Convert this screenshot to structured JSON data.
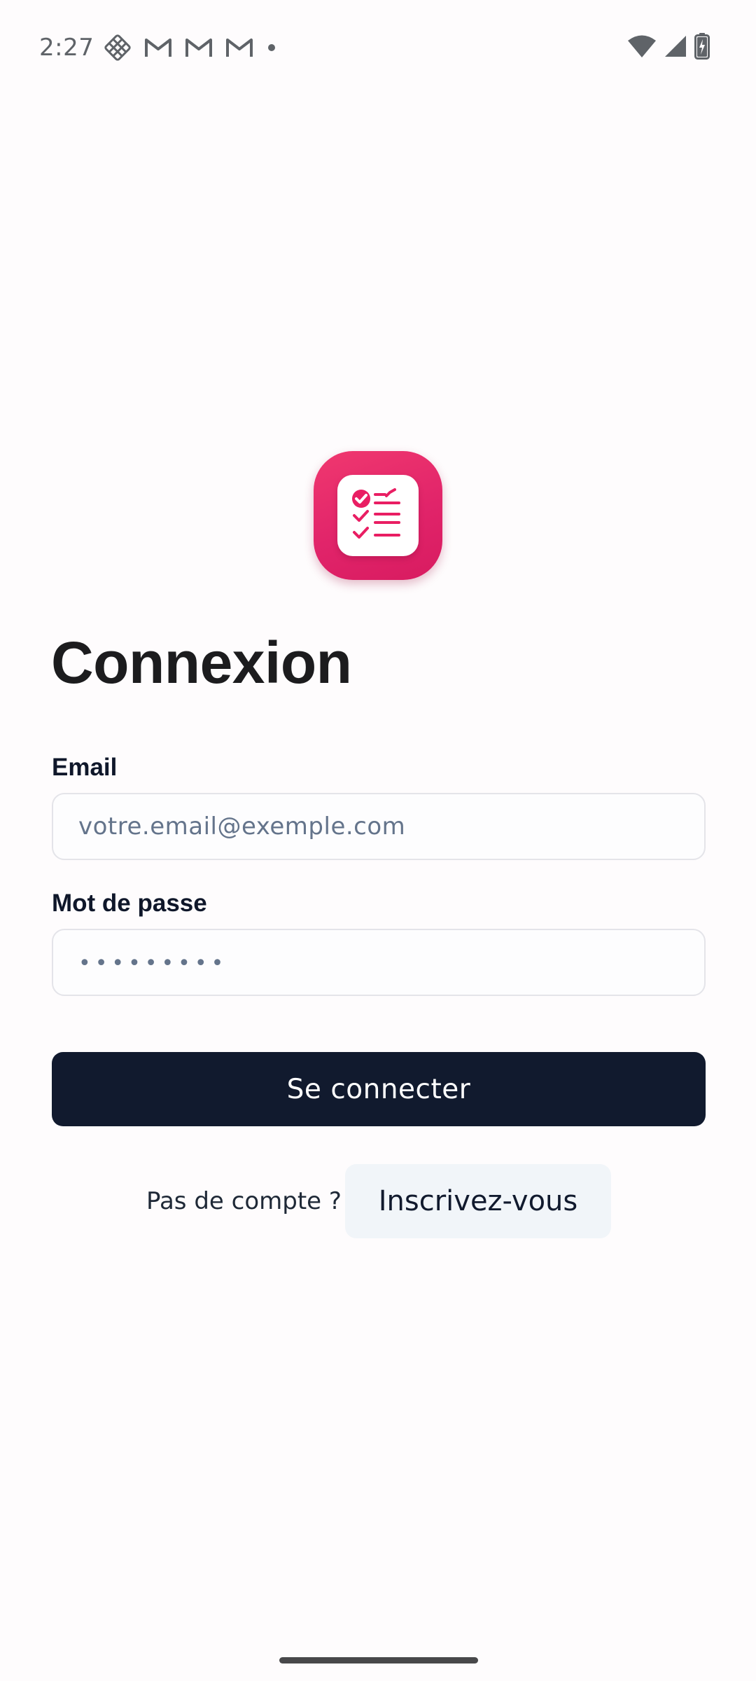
{
  "status_bar": {
    "time": "2:27",
    "left_icons": [
      "grid-app-icon",
      "gmail-icon",
      "gmail-icon",
      "gmail-icon",
      "dot-icon"
    ],
    "right_icons": [
      "wifi-icon",
      "cellular-signal-icon",
      "battery-charging-icon"
    ]
  },
  "app": {
    "logo_icon": "checklist-app-icon",
    "brand_color": "#e91e63"
  },
  "login": {
    "title": "Connexion",
    "email_label": "Email",
    "email_placeholder": "votre.email@exemple.com",
    "email_value": "",
    "password_label": "Mot de passe",
    "password_placeholder": "•••••••••",
    "password_value": "",
    "submit_label": "Se connecter",
    "signup_prompt": "Pas de compte ?",
    "signup_label": "Inscrivez-vous"
  },
  "colors": {
    "primary_button": "#111a2e",
    "secondary_button": "#f1f5f9",
    "input_border": "#e4e4e9",
    "placeholder": "#64748b"
  }
}
